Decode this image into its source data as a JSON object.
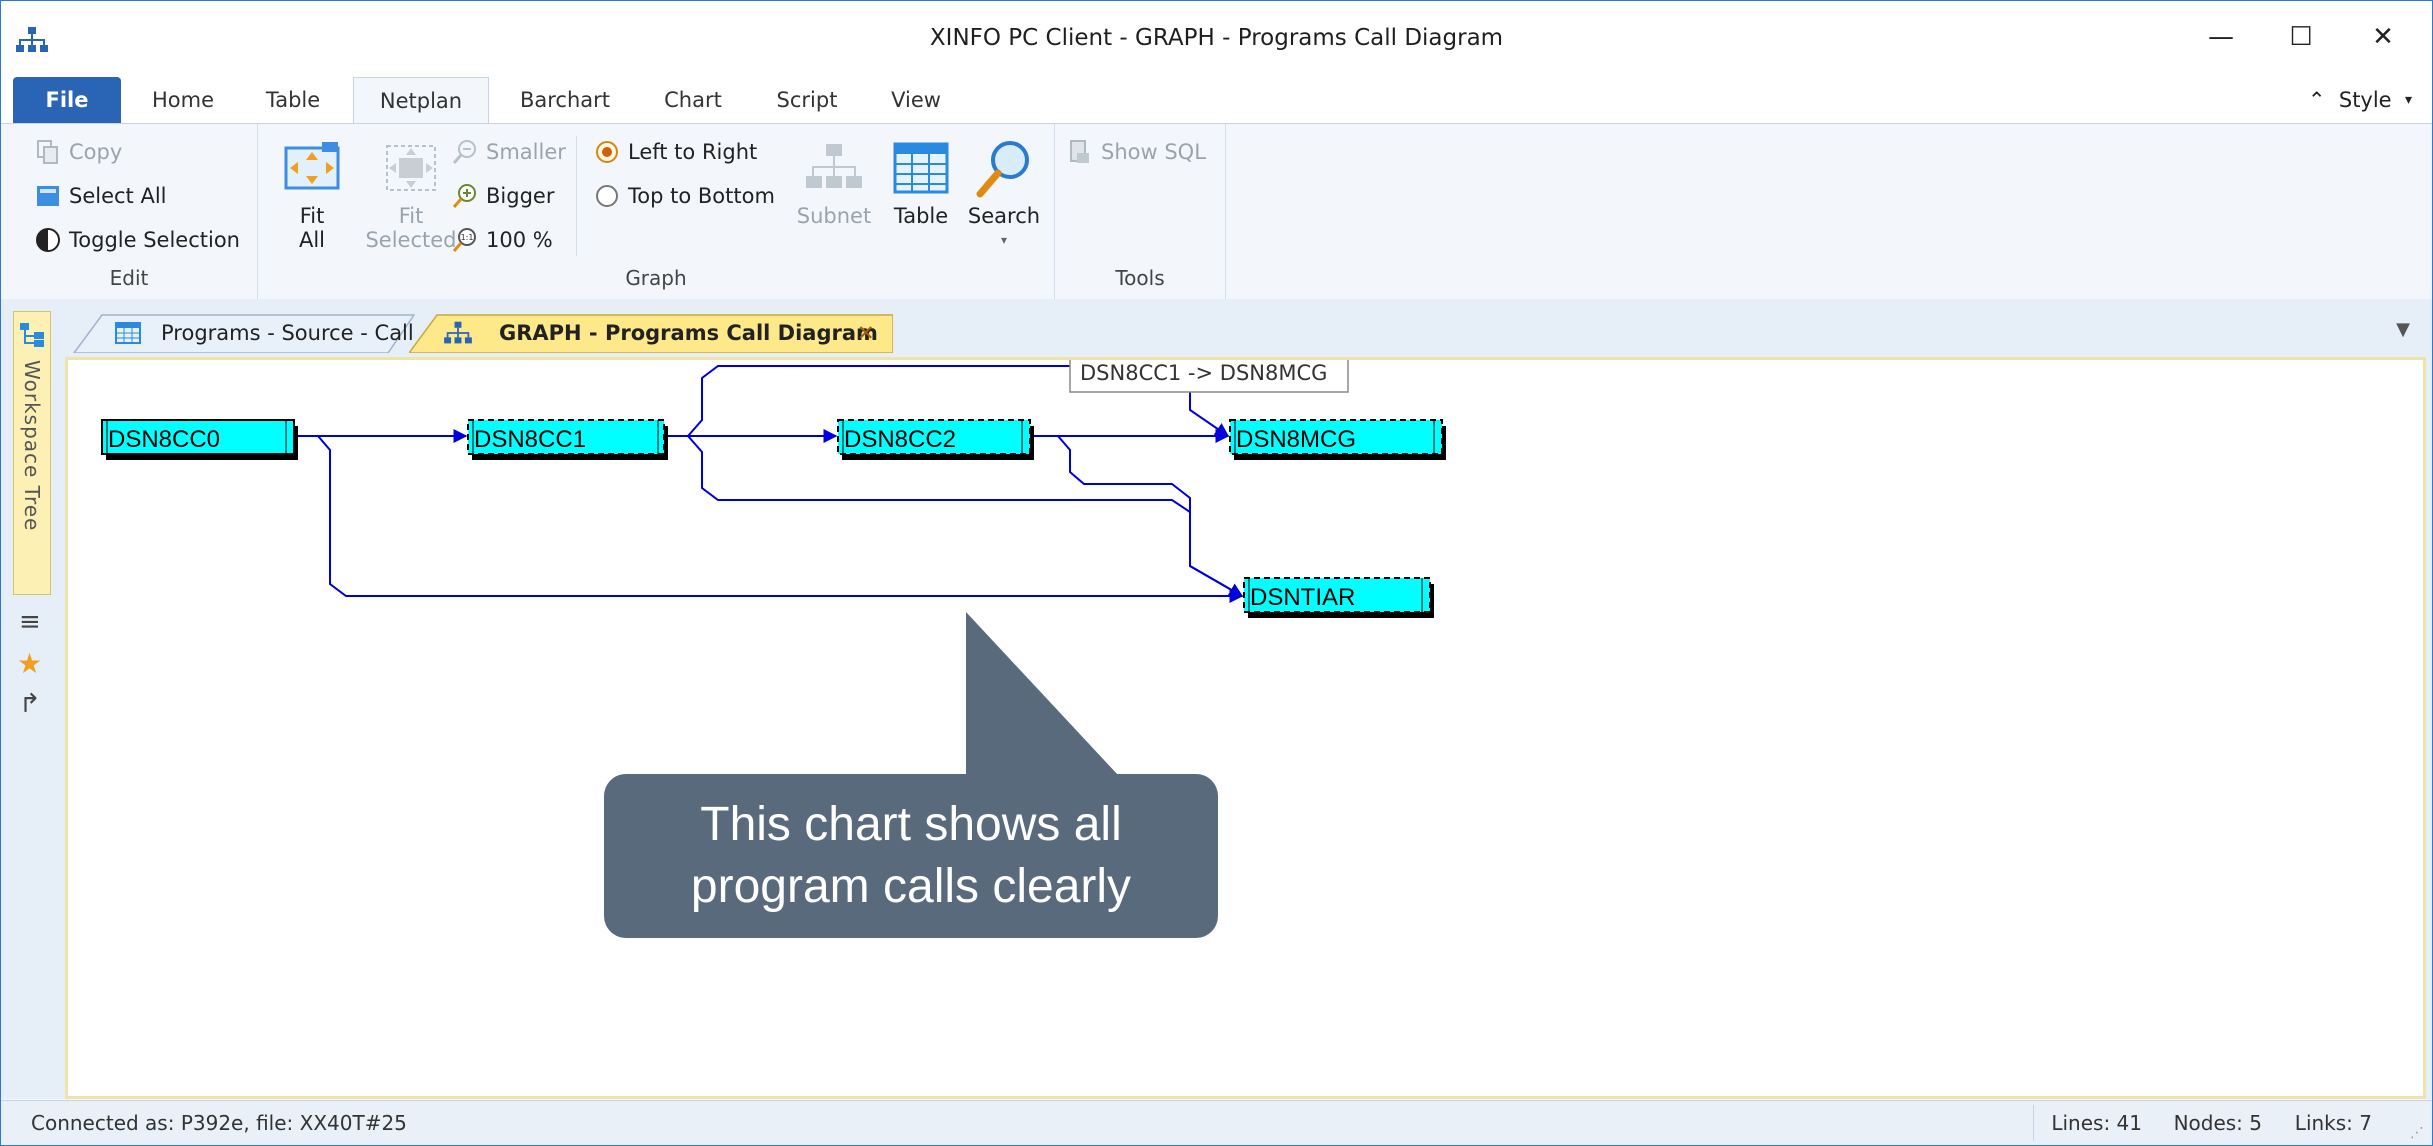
{
  "window": {
    "title": "XINFO PC Client - GRAPH - Programs Call Diagram"
  },
  "window_controls": {
    "minimize": "—",
    "maximize": "☐",
    "close": "✕"
  },
  "ribbon_tabs": [
    "File",
    "Home",
    "Table",
    "Netplan",
    "Barchart",
    "Chart",
    "Script",
    "View"
  ],
  "style_button": "Style",
  "edit_group": {
    "label": "Edit",
    "copy": "Copy",
    "select_all": "Select All",
    "toggle_selection": "Toggle Selection"
  },
  "graph_group": {
    "label": "Graph",
    "fit_all_1": "Fit",
    "fit_all_2": "All",
    "fit_selected_1": "Fit",
    "fit_selected_2": "Selected",
    "smaller": "Smaller",
    "bigger": "Bigger",
    "zoom_100": "100 %",
    "left_to_right": "Left to Right",
    "top_to_bottom": "Top to Bottom",
    "subnet": "Subnet",
    "table": "Table",
    "search": "Search"
  },
  "tools_group": {
    "label": "Tools",
    "show_sql": "Show SQL"
  },
  "workspace_tree": "Workspace Tree",
  "doc_tabs": [
    {
      "label": "Programs - Source - Call"
    },
    {
      "label": "GRAPH - Programs Call Diagram"
    }
  ],
  "graph": {
    "nodes": [
      "DSN8CC0",
      "DSN8CC1",
      "DSN8CC2",
      "DSN8MCG",
      "DSNTIAR"
    ],
    "tooltip": "DSN8CC1 -> DSN8MCG"
  },
  "callout": {
    "line1": "This chart shows all",
    "line2": "program calls clearly"
  },
  "status": {
    "connection": "Connected as: P392e, file: XX40T#25",
    "lines": "Lines: 41",
    "nodes": "Nodes: 5",
    "links": "Links: 7"
  },
  "colors": {
    "node_fill": "#00ffff",
    "edge": "#0000dd",
    "callout": "#586a7c",
    "file_tab": "#2a64b4",
    "active_doc_tab": "#fde88a"
  }
}
